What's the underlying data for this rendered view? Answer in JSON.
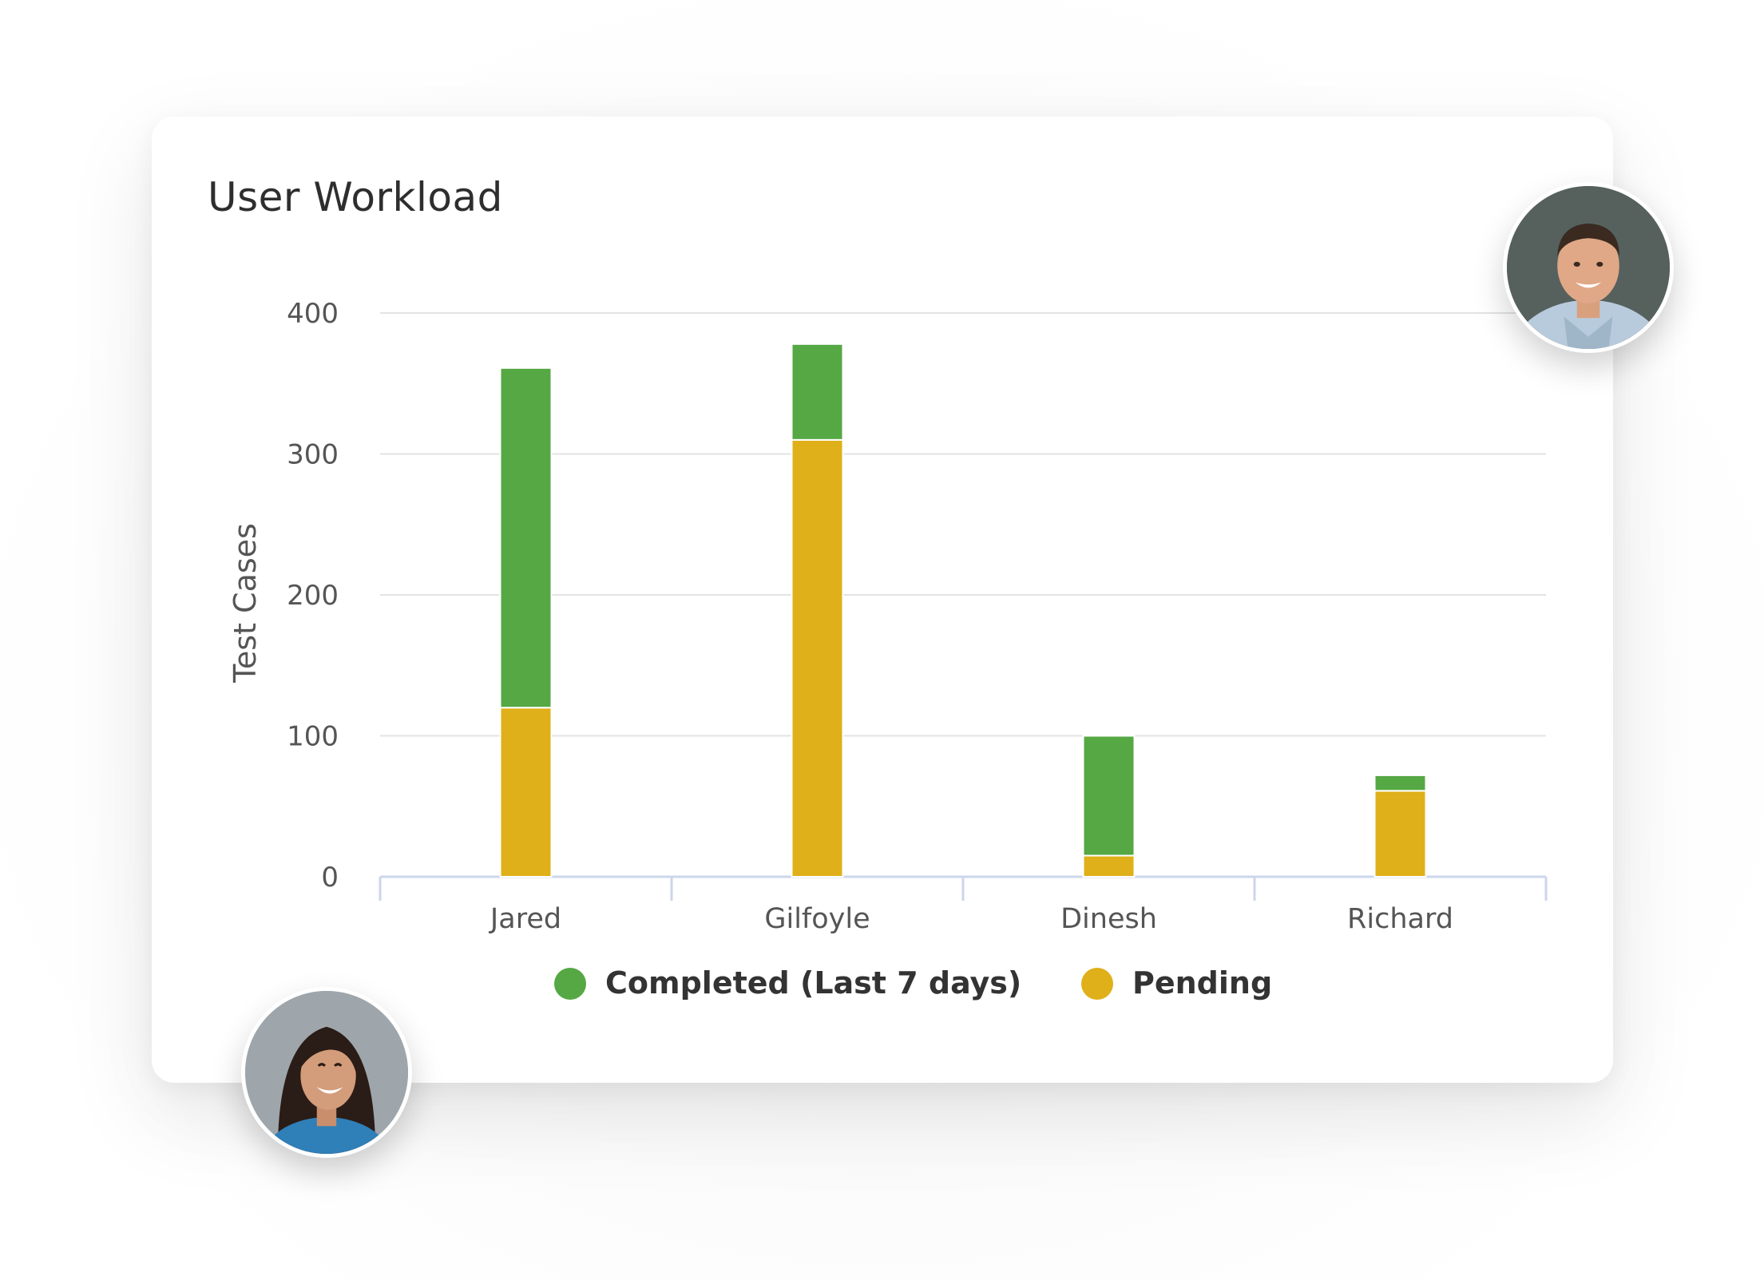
{
  "card": {
    "title": "User Workload"
  },
  "avatars": {
    "top_right": "man-portrait",
    "bottom_left": "woman-portrait"
  },
  "chart_data": {
    "type": "bar",
    "stacked": true,
    "title": "User Workload",
    "xlabel": "",
    "ylabel": "Test Cases",
    "ylim": [
      0,
      400
    ],
    "yticks": [
      0,
      100,
      200,
      300,
      400
    ],
    "grid": true,
    "legend_position": "bottom",
    "categories": [
      "Jared",
      "Gilfoyle",
      "Dinesh",
      "Richard"
    ],
    "series": [
      {
        "name": "Pending",
        "color": "#dfb01a",
        "values": [
          120,
          310,
          15,
          61
        ]
      },
      {
        "name": "Completed (Last 7 days)",
        "color": "#55a843",
        "values": [
          241,
          68,
          85,
          11
        ]
      }
    ],
    "legend_order": [
      "Completed (Last 7 days)",
      "Pending"
    ]
  }
}
